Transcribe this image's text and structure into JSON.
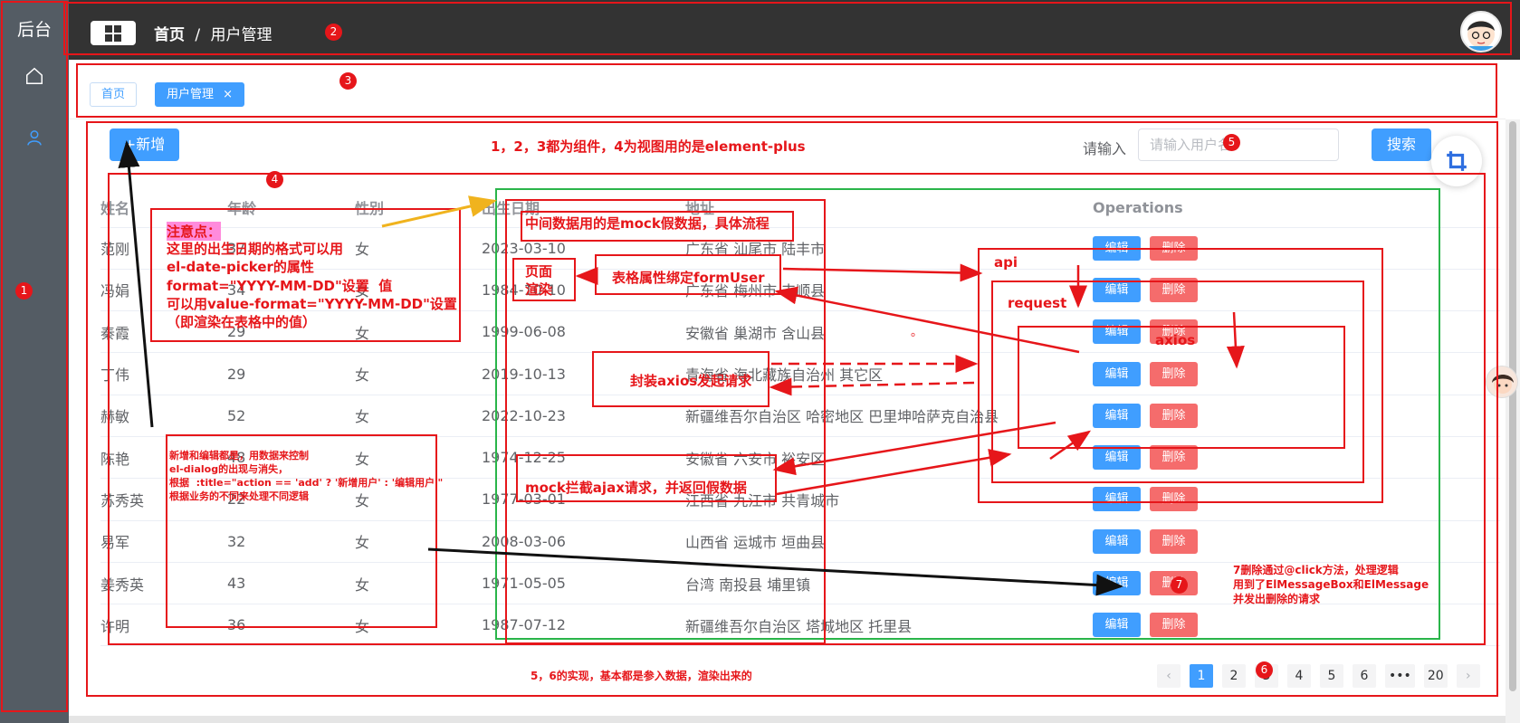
{
  "sidebar": {
    "logo": "后台"
  },
  "header": {
    "crumb_home": "首页",
    "crumb_sep": "/",
    "crumb_current": "用户管理"
  },
  "tags": {
    "home": "首页",
    "user": "用户管理",
    "close": "×"
  },
  "toolbar": {
    "add_label": "+新增",
    "search_label": "请输入",
    "search_placeholder": "请输入用户名",
    "search_button": "搜索"
  },
  "table": {
    "columns": [
      "姓名",
      "年龄",
      "性别",
      "出生日期",
      "地址",
      "Operations"
    ],
    "edit_label": "编辑",
    "delete_label": "删除",
    "rows": [
      [
        "范刚",
        "37",
        "女",
        "2023-03-10",
        "广东省 汕尾市 陆丰市"
      ],
      [
        "冯娟",
        "34",
        "女",
        "1984-10-10",
        "广东省 梅州市 丰顺县"
      ],
      [
        "秦霞",
        "29",
        "女",
        "1999-06-08",
        "安徽省 巢湖市 含山县"
      ],
      [
        "丁伟",
        "29",
        "女",
        "2019-10-13",
        "青海省 海北藏族自治州 其它区"
      ],
      [
        "赫敏",
        "52",
        "女",
        "2022-10-23",
        "新疆维吾尔自治区 哈密地区 巴里坤哈萨克自治县"
      ],
      [
        "陈艳",
        "48",
        "女",
        "1974-12-25",
        "安徽省 六安市 裕安区"
      ],
      [
        "苏秀英",
        "22",
        "女",
        "1977-03-01",
        "江西省 九江市 共青城市"
      ],
      [
        "易军",
        "32",
        "女",
        "2008-03-06",
        "山西省 运城市 垣曲县"
      ],
      [
        "姜秀英",
        "43",
        "女",
        "1971-05-05",
        "台湾 南投县 埔里镇"
      ],
      [
        "许明",
        "36",
        "女",
        "1987-07-12",
        "新疆维吾尔自治区 塔城地区 托里县"
      ]
    ]
  },
  "pagination": {
    "prev": "‹",
    "pages": [
      "1",
      "2",
      "3",
      "4",
      "5",
      "6"
    ],
    "ellipsis": "•••",
    "last": "20",
    "next": "›",
    "current": "1"
  },
  "annotations": {
    "numbers": [
      "1",
      "2",
      "3",
      "4",
      "5",
      "6",
      "7"
    ],
    "top_note": "1，2，3都为组件，4为视图用的是element-plus",
    "attention_title": "注意点：",
    "attention_body": "这里的出生日期的格式可以用\nel-date-picker的属性\nformat=\"YYYY-MM-DD\"设置  值\n可以用value-format=\"YYYY-MM-DD\"设置\n（即渲染在表格中的值）",
    "mock_flow": "中间数据用的是mock假数据，具体流程",
    "page_render": "页面\n渲染",
    "table_bind": "表格属性绑定formUser",
    "axios_wrap": "封装axios发起请求",
    "mock_intercept": "mock拦截ajax请求，并返回假数据",
    "api": "api",
    "request": "request",
    "axios": "axios",
    "dialog_note": "新增和编辑都是，用数据来控制\nel-dialog的出现与消失，\n根据  :title=\"action == 'add' ? '新增用户' : '编辑用户'\"\n根据业务的不同来处理不同逻辑",
    "delete_note": "7删除通过@click方法，处理逻辑\n用到了ElMessageBox和ElMessage\n并发出删除的请求",
    "pager_note": "5，6的实现，基本都是参入数据，渲染出来的",
    "dot": "。"
  },
  "colors": {
    "primary": "#409eff",
    "danger": "#f56c6c",
    "sidebar": "#545c64",
    "header": "#333333",
    "annotation": "#e6161a",
    "view_box": "#2ab54a"
  }
}
